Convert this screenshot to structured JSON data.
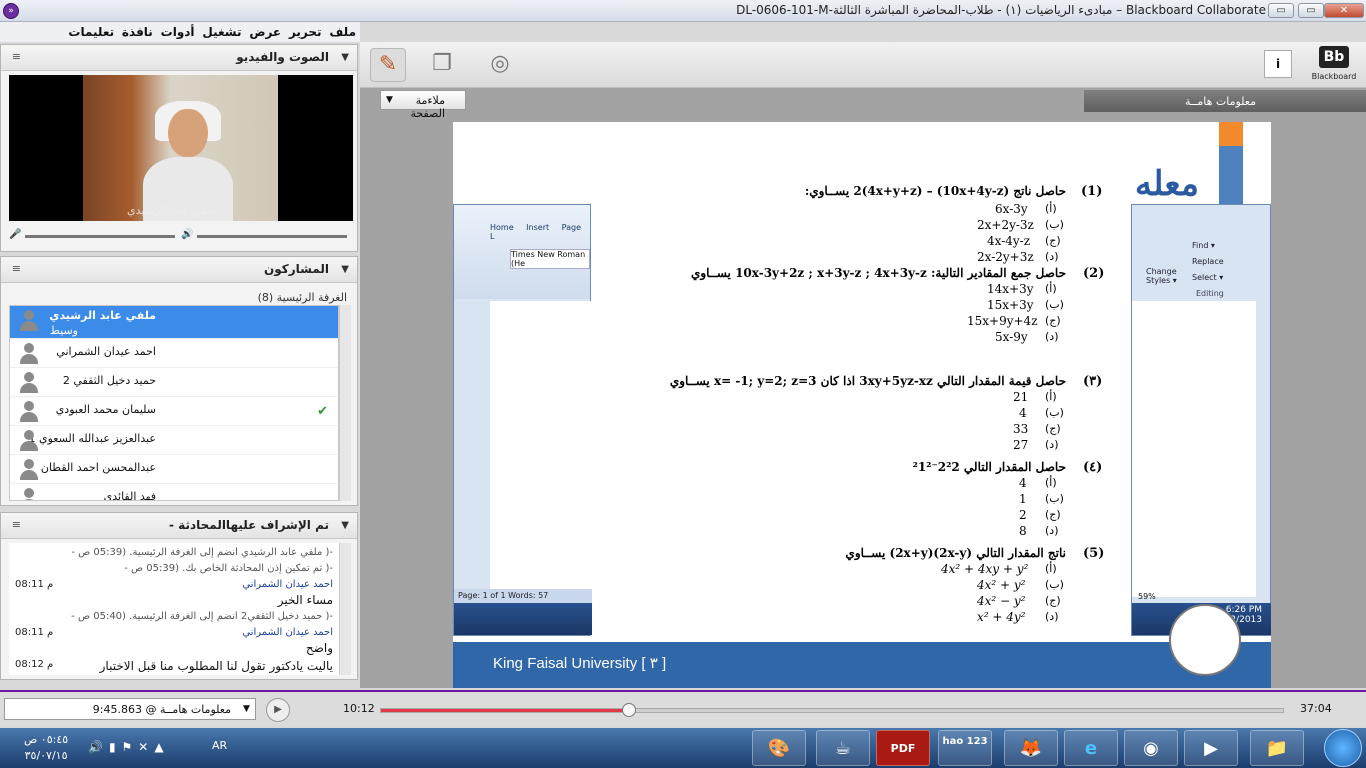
{
  "window": {
    "title": "DL-0606-101-M-مبادىء الرياضيات (١) - طلاب-المحاضرة المباشرة الثالثة – Blackboard Collaborate",
    "min": "▭",
    "max": "▭",
    "close": "✕"
  },
  "menu": [
    "ملف",
    "تحرير",
    "عرض",
    "تشغيل",
    "أدوات",
    "نافذة",
    "تعليمات"
  ],
  "av_panel": {
    "title": "الصوت والفيديو",
    "caption": "ملفي عابد الرشيدي"
  },
  "participants": {
    "title": "المشاركون",
    "room": "الغرفة الرئيسية",
    "count": "(8)",
    "items": [
      {
        "name": "ملفي عابد الرشيدي",
        "role": "وسيط",
        "selected": true
      },
      {
        "name": "احمد عيدان الشمراني",
        "status": ""
      },
      {
        "name": "حميد دخيل الثقفي 2",
        "status": ""
      },
      {
        "name": "سليمان محمد العبودي",
        "status": "✔"
      },
      {
        "name": "عبدالعزيز عبدالله السعوي 1",
        "status": ""
      },
      {
        "name": "عبدالمحسن احمد القطان",
        "status": ""
      },
      {
        "name": "فهد القائدي",
        "status": ""
      }
    ]
  },
  "chat": {
    "title": "تم الإشراف عليهاالمحادثة -",
    "lines": [
      {
        "type": "sys",
        "text": "-( ملفي عابد الرشيدي انضم إلى الغرفة الرئيسية. (05:39 ص -"
      },
      {
        "type": "sys",
        "text": "-( تم تمكين إذن المحادثة الخاص بك. (05:39 ص -"
      },
      {
        "type": "sender",
        "name": "احمد عيدان الشمراني",
        "time": "م 08:11"
      },
      {
        "type": "msg",
        "text": "مساء الخير"
      },
      {
        "type": "sys",
        "text": "-( حميد دخيل الثقفي2 انضم إلى الغرفة الرئيسية. (05:40 ص -"
      },
      {
        "type": "sender",
        "name": "احمد عيدان الشمراني",
        "time": "م 08:11"
      },
      {
        "type": "msg",
        "text": "واضح"
      },
      {
        "type": "msgt",
        "text": "ياليت يادكتور تقول لنا المطلوب منا قبل الاختبار",
        "time": "م 08:12"
      }
    ]
  },
  "stage": {
    "fit": "ملاءمة الصفحة",
    "info_tab": "معلومات هامــة",
    "info_btn": "i",
    "bb_logo": "Bb",
    "bb_text": "Blackboard"
  },
  "slide": {
    "logo": "معله",
    "footer": "King Faisal University [ ٣ ]",
    "word": {
      "tabs": [
        "Home",
        "Insert",
        "Page L"
      ],
      "font": "Times New Roman (He",
      "status": "Page: 1 of 1   Words: 57",
      "find": "Find ▾",
      "replace": "Replace",
      "select": "Select ▾",
      "editing": "Editing",
      "change": "Change Styles ▾",
      "zoom": "59%",
      "time": "6:26 PM",
      "date": "10/2/2013"
    },
    "questions": [
      {
        "n": "(1)",
        "q": "حاصل ناتج (10x+4y-z) – 2(4x+y+z) يســاوي:",
        "opts": [
          [
            "(أ)",
            "6x-3y"
          ],
          [
            "(ب)",
            "2x+2y-3z"
          ],
          [
            "(ج)",
            "4x-4y-z"
          ],
          [
            "(د)",
            "2x-2y+3z"
          ]
        ]
      },
      {
        "n": "(2)",
        "q": "حاصل جمع المقادير التالية: 10x-3y+2z ; x+3y-z ; 4x+3y-z يســاوي",
        "opts": [
          [
            "(أ)",
            "14x+3y"
          ],
          [
            "(ب)",
            "15x+3y"
          ],
          [
            "(ج)",
            "15x+9y+4z"
          ],
          [
            "(د)",
            "5x-9y"
          ]
        ]
      },
      {
        "n": "(٣)",
        "q": "حاصل قيمة المقدار التالي 3xy+5yz-xz اذا كان x= -1; y=2; z=3 يســاوي",
        "opts": [
          [
            "(أ)",
            "21"
          ],
          [
            "(ب)",
            "4"
          ],
          [
            "(ج)",
            "33"
          ],
          [
            "(د)",
            "27"
          ]
        ]
      },
      {
        "n": "(٤)",
        "q": "حاصل المقدار التالي 2²2⁻²1²",
        "opts": [
          [
            "(أ)",
            "4"
          ],
          [
            "(ب)",
            "1"
          ],
          [
            "(ج)",
            "2"
          ],
          [
            "(د)",
            "8"
          ]
        ]
      },
      {
        "n": "(5)",
        "q": "ناتج المقدار التالي (2x-y)(2x+y) يســاوي",
        "opts": [
          [
            "(أ)",
            "4x² + 4xy + y²"
          ],
          [
            "(ب)",
            "4x² + y²"
          ],
          [
            "(ج)",
            "4x² − y²"
          ],
          [
            "(د)",
            "x² + 4y²"
          ]
        ]
      }
    ]
  },
  "playback": {
    "bookmark": "معلومات هامــة @ 9:45.863",
    "current": "10:12",
    "total": "37:04",
    "progress": 0.275
  },
  "taskbar": {
    "time": "٠٥:٤٥ ص",
    "date": "٣٥/٠٧/١٥",
    "lang": "AR",
    "apps": [
      "🎨",
      "☕",
      "PDF",
      "hao 123",
      "🦊",
      "e",
      "◉",
      "▶",
      "📁"
    ]
  }
}
